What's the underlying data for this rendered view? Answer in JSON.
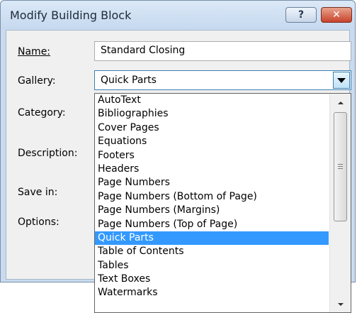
{
  "window": {
    "title": "Modify Building Block",
    "help_symbol": "?",
    "close_symbol": "✕"
  },
  "form": {
    "name_label": "Name:",
    "name_value": "Standard Closing",
    "gallery_label": "Gallery:",
    "gallery_value": "Quick Parts",
    "category_label": "Category:",
    "description_label": "Description:",
    "save_in_label": "Save in:",
    "options_label": "Options:"
  },
  "dropdown": {
    "items": [
      "AutoText",
      "Bibliographies",
      "Cover Pages",
      "Equations",
      "Footers",
      "Headers",
      "Page Numbers",
      "Page Numbers (Bottom of Page)",
      "Page Numbers (Margins)",
      "Page Numbers (Top of Page)",
      "Quick Parts",
      "Table of Contents",
      "Tables",
      "Text Boxes",
      "Watermarks"
    ],
    "selected_index": 10
  },
  "colors": {
    "selection": "#3399ff",
    "titlebar": "#c9dbef",
    "close_button": "#c8432b"
  }
}
